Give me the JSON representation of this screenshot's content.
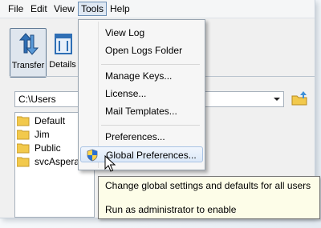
{
  "menubar": {
    "items": [
      "File",
      "Edit",
      "View",
      "Tools",
      "Help"
    ],
    "open_item": "Tools"
  },
  "toolbar": {
    "buttons": [
      {
        "label": "Transfer",
        "icon": "transfer-arrows-icon",
        "pressed": true
      },
      {
        "label": "Details",
        "icon": "details-icon",
        "pressed": false
      }
    ]
  },
  "path_bar": {
    "value": "C:\\Users"
  },
  "tree": {
    "items": [
      "Default",
      "Jim",
      "Public",
      "svcAspera"
    ]
  },
  "tools_menu": {
    "items": [
      {
        "label": "View Log"
      },
      {
        "label": "Open Logs Folder"
      },
      {
        "label": "Manage Keys..."
      },
      {
        "label": "License..."
      },
      {
        "label": "Mail Templates..."
      },
      {
        "label": "Preferences..."
      },
      {
        "label": "Global Preferences...",
        "icon": "uac-shield-icon",
        "highlighted": true
      }
    ]
  },
  "tooltip": {
    "line1": "Change global settings and defaults for all users",
    "line2": "Run as administrator to enable"
  },
  "colors": {
    "menu_highlight": "#dbe8f8",
    "tooltip_bg": "#fdfde8",
    "folder": "#f2c94c",
    "transfer_icon": "#2f6fb5"
  }
}
